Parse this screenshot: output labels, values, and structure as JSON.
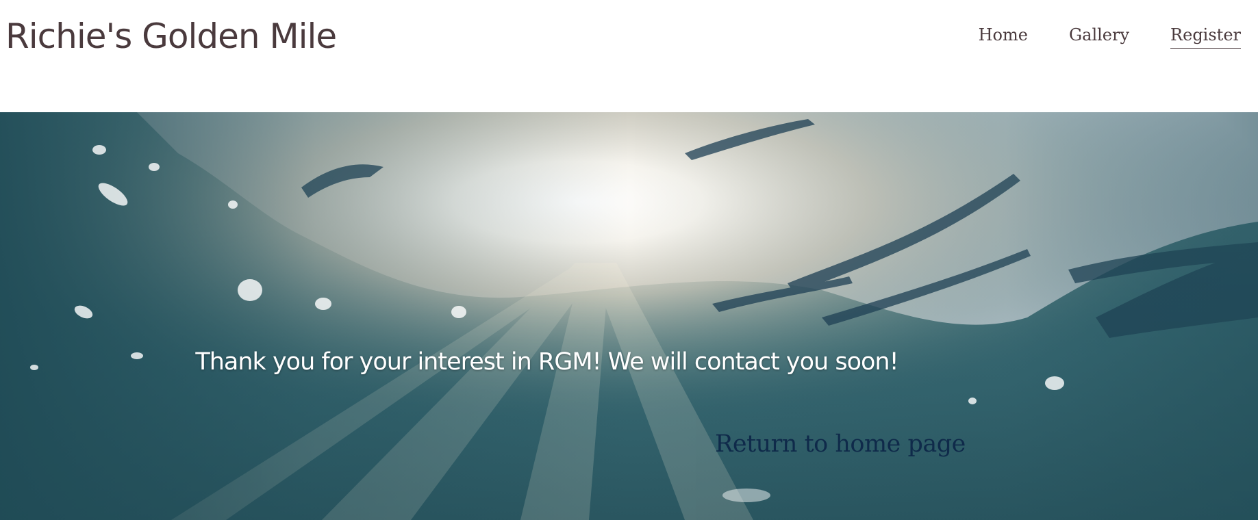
{
  "header": {
    "site_title": "Richie's Golden Mile",
    "nav": [
      {
        "label": "Home"
      },
      {
        "label": "Gallery"
      },
      {
        "label": "Register",
        "active": true
      }
    ]
  },
  "hero": {
    "background": "underwater-sunlight-image",
    "message": "Thank you for your interest in RGM! We will contact you soon!",
    "return_link": "Return to home page"
  },
  "colors": {
    "text_dark": "#4a3a3d",
    "link_navy": "#0f2a4a",
    "water": "#2e5a63"
  }
}
